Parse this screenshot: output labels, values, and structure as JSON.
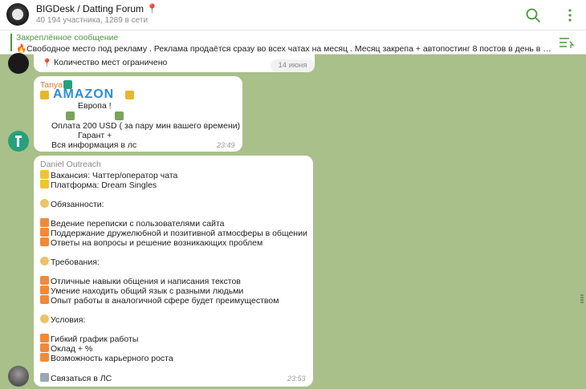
{
  "header": {
    "title": "BIGDesk / Datting Forum 📍",
    "subtitle": "40 194 участника, 1289 в сети",
    "search_icon": "search-icon",
    "menu_icon": "more-vertical-icon"
  },
  "pinned": {
    "title": "Закреплённое сообщение",
    "text": "🔥Свободное место под рекламу . Реклама продаётся сразу во всех чатах на месяц . Месяц закрепа + автопостинг 8 постов в день в ка...",
    "icon": "pinned-list-icon"
  },
  "date_pill": "14 июня",
  "messages": [
    {
      "lines": [
        "Количество мест ограничено"
      ]
    },
    {
      "sender": "Tanya",
      "logo_word": "AMAZON",
      "lines": [
        "Европа !",
        "Оплата 200 USD ( за пару мин вашего времени)",
        "Гарант +",
        "Вся информация в лс"
      ],
      "time": "23:49"
    },
    {
      "sender": "Daniel Outreach",
      "lines": [
        "Вакансия: Чаттер/оператор чата",
        "Платформа: Dream Singles",
        "Обязанности:",
        "Ведение переписки с пользователями сайта",
        "Поддержание дружелюбной и позитивной атмосферы в общении",
        "Ответы на вопросы и решение возникающих проблем",
        "Требования:",
        "Отличные навыки общения и написания текстов",
        "Умение находить общий язык с разными людьми",
        "Опыт работы в аналогичной сфере будет преимуществом",
        "Условия:",
        "Гибкий график работы",
        "Оклад + %",
        "Возможность карьерного роста",
        "Связаться в ЛС"
      ],
      "time": "23:53"
    }
  ],
  "colors": {
    "accent": "#4a9b3d",
    "wallpaper": "#a9c08a",
    "sender_tanya": "#d9772b",
    "sender_daniel": "#8a8a8a"
  }
}
